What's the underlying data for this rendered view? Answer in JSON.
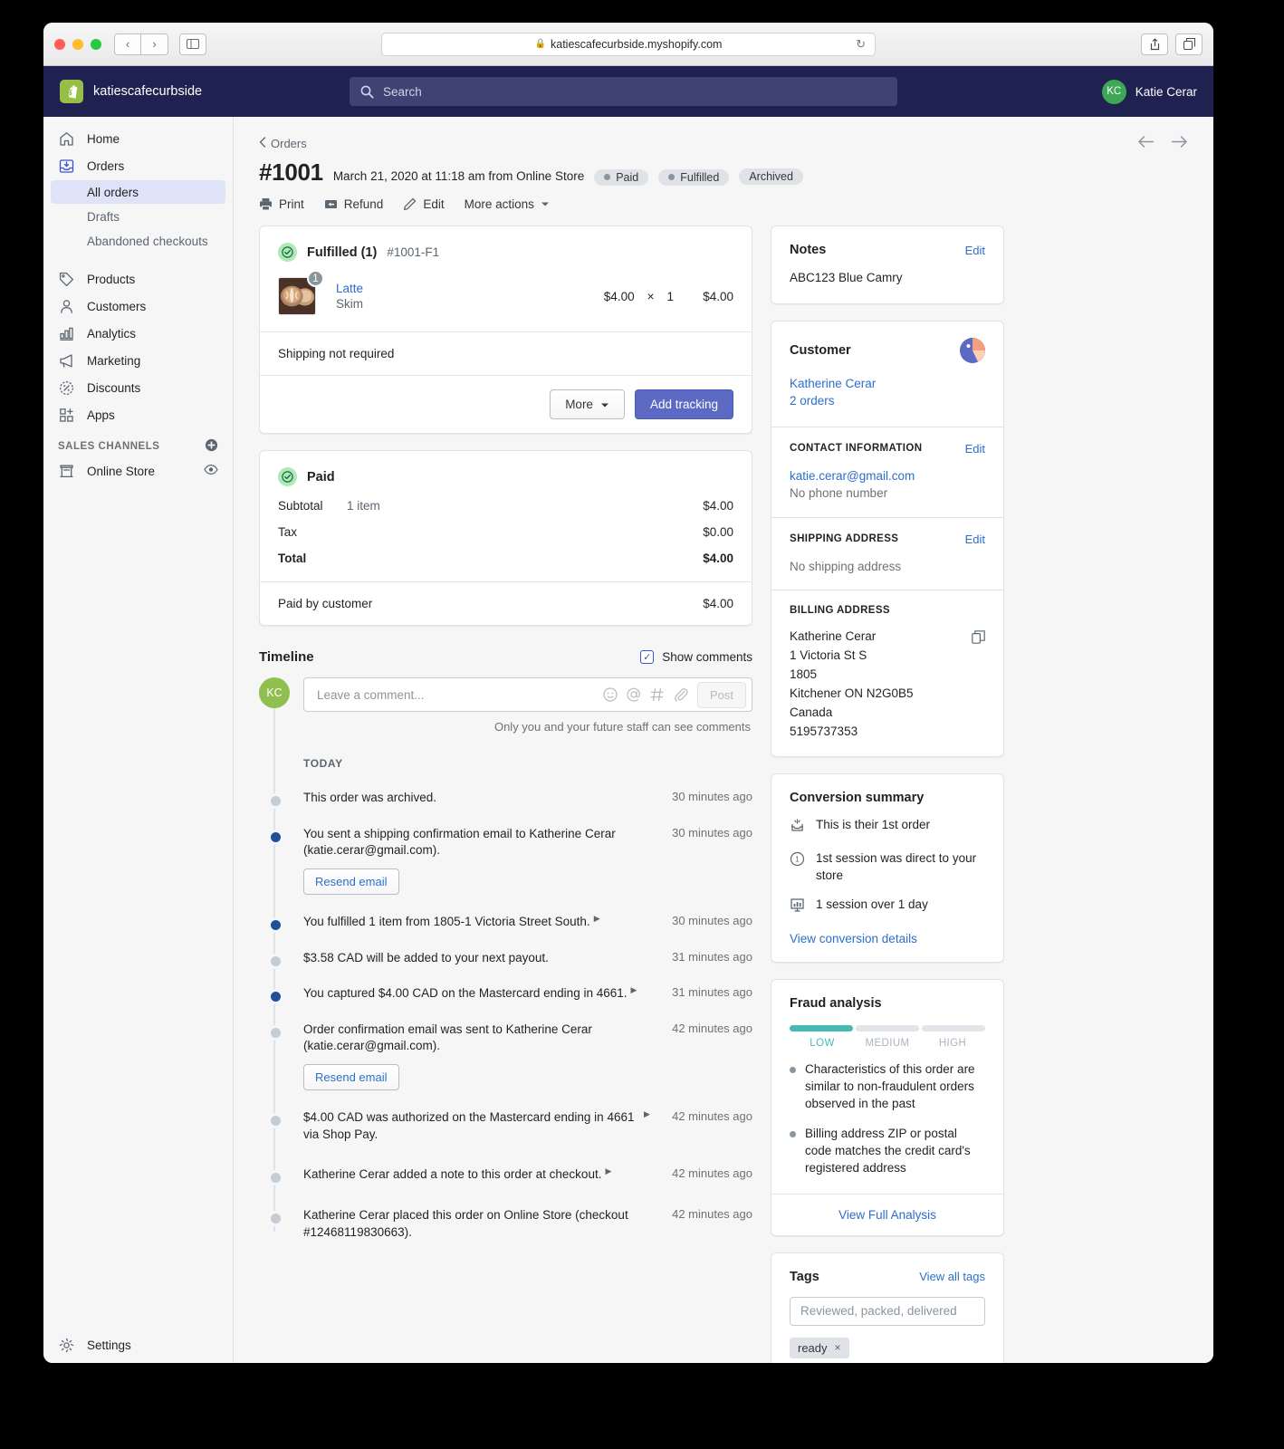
{
  "browser": {
    "url": "katiescafecurbside.myshopify.com",
    "back_label": "‹",
    "forward_label": "›",
    "sidebar_toggle": "sidebar-toggle",
    "reload_label": "↻",
    "share_label": "share",
    "tabs_label": "tabs",
    "new_tab_label": "+"
  },
  "topbar": {
    "store_name": "katiescafecurbside",
    "search_placeholder": "Search",
    "user_initials": "KC",
    "user_name": "Katie Cerar"
  },
  "sidebar": {
    "items": [
      {
        "label": "Home",
        "icon": "home-icon"
      },
      {
        "label": "Orders",
        "icon": "orders-icon"
      },
      {
        "label": "Products",
        "icon": "tag-icon"
      },
      {
        "label": "Customers",
        "icon": "person-icon"
      },
      {
        "label": "Analytics",
        "icon": "bar-chart-icon"
      },
      {
        "label": "Marketing",
        "icon": "megaphone-icon"
      },
      {
        "label": "Discounts",
        "icon": "discount-icon"
      },
      {
        "label": "Apps",
        "icon": "apps-icon"
      }
    ],
    "order_subitems": [
      {
        "label": "All orders",
        "selected": true
      },
      {
        "label": "Drafts",
        "selected": false
      },
      {
        "label": "Abandoned checkouts",
        "selected": false
      }
    ],
    "sales_channels_label": "SALES CHANNELS",
    "add_channel_icon": "plus-circle-icon",
    "online_store": {
      "label": "Online Store",
      "icon": "store-icon",
      "view_icon": "eye-icon"
    },
    "settings_label": "Settings",
    "settings_icon": "gear-icon"
  },
  "order": {
    "breadcrumb": "Orders",
    "number": "#1001",
    "meta": "March 21, 2020 at 11:18 am from Online Store",
    "badges": [
      {
        "label": "Paid",
        "has_pip": true
      },
      {
        "label": "Fulfilled",
        "has_pip": true
      },
      {
        "label": "Archived",
        "has_pip": false
      }
    ],
    "actions": [
      {
        "label": "Print",
        "icon": "printer-icon"
      },
      {
        "label": "Refund",
        "icon": "refund-icon"
      },
      {
        "label": "Edit",
        "icon": "pencil-icon"
      },
      {
        "label": "More actions",
        "icon": "chevron-down-icon"
      }
    ],
    "prev_icon": "arrow-left-icon",
    "next_icon": "arrow-right-icon"
  },
  "fulfilled_card": {
    "title": "Fulfilled (1)",
    "reference": "#1001-F1",
    "item": {
      "quantity_badge": "1",
      "name": "Latte",
      "variant": "Skim",
      "unit_price": "$4.00",
      "times": "×",
      "quantity": "1",
      "total": "$4.00"
    },
    "shipping_note": "Shipping not required",
    "more_button": "More",
    "add_tracking_button": "Add tracking"
  },
  "paid_card": {
    "title": "Paid",
    "rows": [
      {
        "label": "Subtotal",
        "desc": "1 item",
        "amount": "$4.00",
        "bold": false
      },
      {
        "label": "Tax",
        "desc": "",
        "amount": "$0.00",
        "bold": false
      },
      {
        "label": "Total",
        "desc": "",
        "amount": "$4.00",
        "bold": true
      }
    ],
    "paid_by_label": "Paid by customer",
    "paid_by_amount": "$4.00"
  },
  "timeline": {
    "title": "Timeline",
    "show_comments_label": "Show comments",
    "comment_avatar": "KC",
    "comment_placeholder": "Leave a comment...",
    "post_label": "Post",
    "hint": "Only you and your future staff can see comments",
    "day_label": "TODAY",
    "entries": [
      {
        "text": "This order was archived.",
        "time": "30 minutes ago",
        "filled": false,
        "caret": false,
        "button": ""
      },
      {
        "text": "You sent a shipping confirmation email to Katherine Cerar (katie.cerar@gmail.com).",
        "time": "30 minutes ago",
        "filled": true,
        "caret": false,
        "button": "Resend email"
      },
      {
        "text": "You fulfilled 1 item from 1805-1 Victoria Street South.",
        "time": "30 minutes ago",
        "filled": true,
        "caret": true,
        "button": ""
      },
      {
        "text": "$3.58 CAD will be added to your next payout.",
        "time": "31 minutes ago",
        "filled": false,
        "caret": false,
        "button": ""
      },
      {
        "text": "You captured $4.00 CAD on the Mastercard ending in 4661.",
        "time": "31 minutes ago",
        "filled": true,
        "caret": true,
        "button": ""
      },
      {
        "text": "Order confirmation email was sent to Katherine Cerar (katie.cerar@gmail.com).",
        "time": "42 minutes ago",
        "filled": false,
        "caret": false,
        "button": "Resend email"
      },
      {
        "text": "$4.00 CAD was authorized on the Mastercard ending in 4661 via Shop Pay.",
        "time": "42 minutes ago",
        "filled": false,
        "caret": true,
        "button": ""
      },
      {
        "text": "Katherine Cerar added a note to this order at checkout.",
        "time": "42 minutes ago",
        "filled": false,
        "caret": true,
        "button": ""
      },
      {
        "text": "Katherine Cerar placed this order on Online Store (checkout #12468119830663).",
        "time": "42 minutes ago",
        "filled": false,
        "caret": false,
        "button": ""
      }
    ]
  },
  "notes_card": {
    "title": "Notes",
    "edit_label": "Edit",
    "body": "ABC123 Blue Camry"
  },
  "customer_card": {
    "title": "Customer",
    "name": "Katherine Cerar",
    "orders_count": "2 orders",
    "contact_label": "CONTACT INFORMATION",
    "contact_edit": "Edit",
    "email": "katie.cerar@gmail.com",
    "phone": "No phone number",
    "shipping_label": "SHIPPING ADDRESS",
    "shipping_edit": "Edit",
    "shipping_value": "No shipping address",
    "billing_label": "BILLING ADDRESS",
    "billing_lines": [
      "Katherine Cerar",
      "1 Victoria St S",
      "1805",
      "Kitchener ON N2G0B5",
      "Canada",
      "5195737353"
    ],
    "copy_icon": "copy-icon"
  },
  "conversion_card": {
    "title": "Conversion summary",
    "rows": [
      {
        "text": "This is their 1st order",
        "icon": "first-order-icon"
      },
      {
        "text": "1st session was direct to your store",
        "icon": "clock-icon"
      },
      {
        "text": "1 session over 1 day",
        "icon": "sessions-chart-icon"
      }
    ],
    "link": "View conversion details"
  },
  "fraud_card": {
    "title": "Fraud analysis",
    "risk_level": "LOW",
    "levels": [
      "LOW",
      "MEDIUM",
      "HIGH"
    ],
    "risk_color": "#47b9b5",
    "points": [
      "Characteristics of this order are similar to non-fraudulent orders observed in the past",
      "Billing address ZIP or postal code matches the credit card's registered address"
    ],
    "view_full": "View Full Analysis"
  },
  "tags_card": {
    "title": "Tags",
    "view_all": "View all tags",
    "input_placeholder": "Reviewed, packed, delivered",
    "chips": [
      {
        "label": "ready",
        "remove": "×"
      }
    ]
  }
}
